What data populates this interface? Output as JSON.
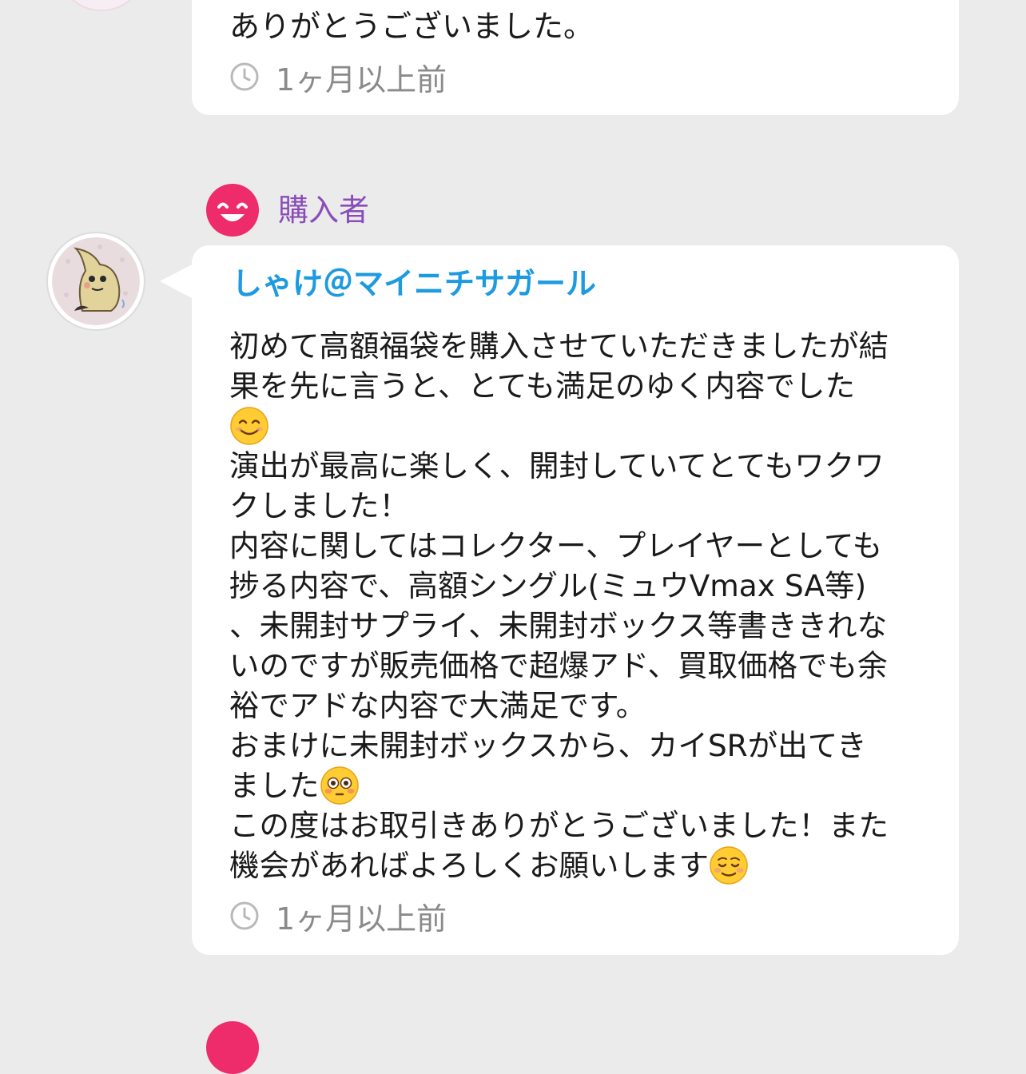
{
  "previous_review": {
    "last_line": "ありがとうございました。",
    "timestamp": "1ヶ月以上前",
    "clock_icon": "clock-icon"
  },
  "review": {
    "role_label": "購入者",
    "role_icon": "smile-face-icon",
    "role_color": "#ee2b6b",
    "user_name": "しゃけ＠マイニチサガール",
    "user_color": "#1e9be0",
    "lines": [
      "初めて高額福袋を購入させていただきましたが結",
      "果を先に言うと、とても満足のゆく内容でした",
      "",
      "演出が最高に楽しく、開封していてとてもワクワ",
      "クしました！",
      "内容に関してはコレクター、プレイヤーとしても",
      "捗る内容で、高額シングル(ミュウVmax SA等)",
      "、未開封サプライ、未開封ボックス等書ききれな",
      "いのですが販売価格で超爆アド、買取価格でも余",
      "裕でアドな内容で大満足です。",
      "おまけに未開封ボックスから、カイSRが出てき",
      "ました",
      "この度はお取引きありがとうございました！また",
      "機会があればよろしくお願いします"
    ],
    "emojis": [
      "smiling-face-emoji",
      "flushed-face-emoji",
      "relieved-face-emoji"
    ],
    "timestamp": "1ヶ月以上前"
  }
}
